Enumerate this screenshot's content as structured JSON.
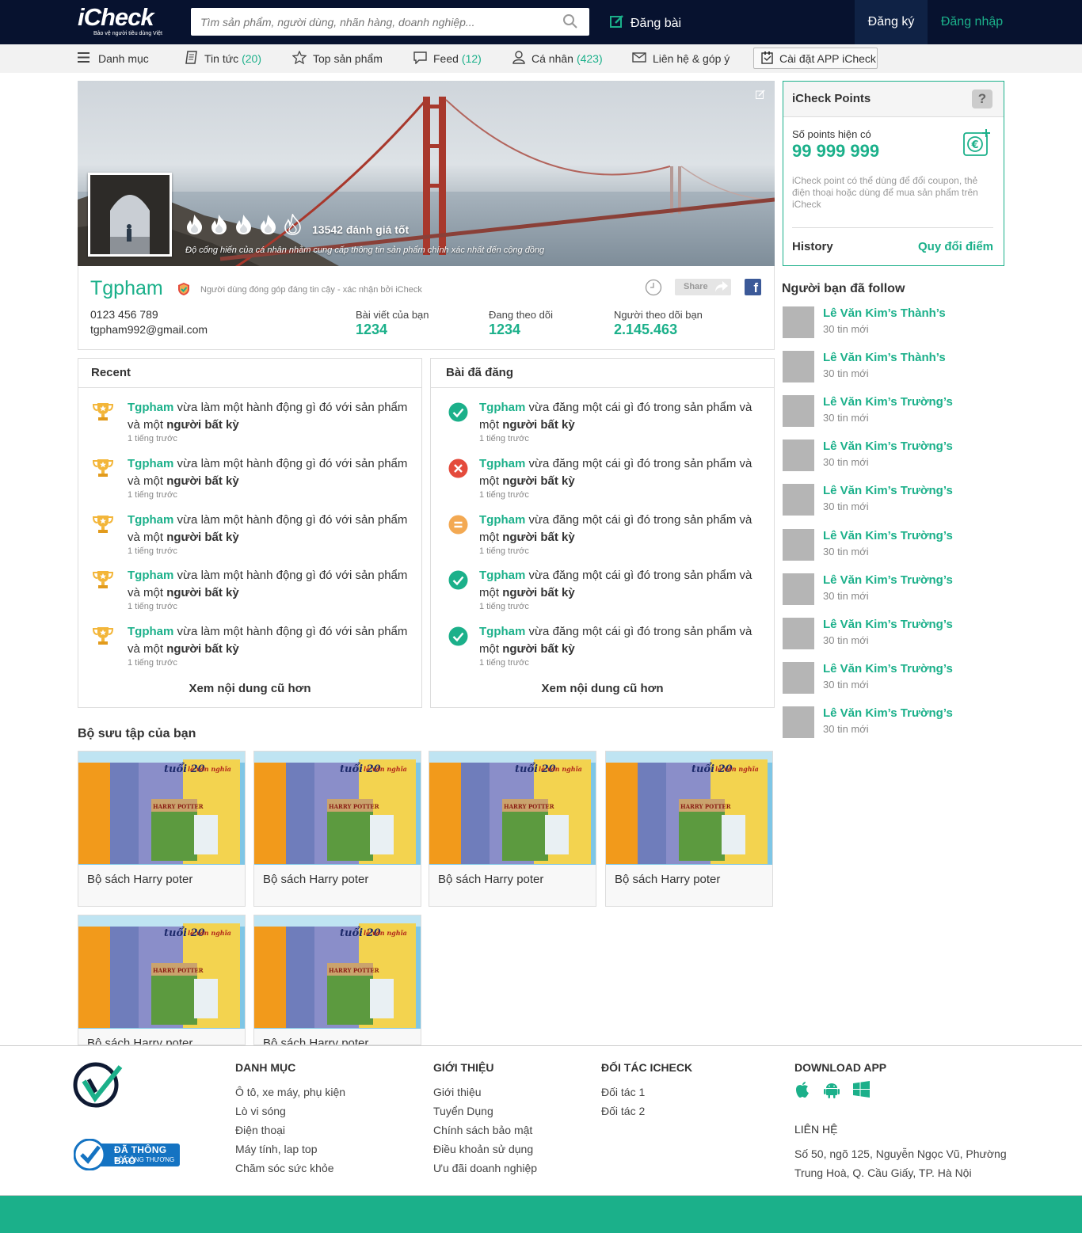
{
  "header": {
    "logo_text": "iCheck",
    "logo_tagline": "Bảo vệ người tiêu dùng Việt",
    "search_placeholder": "Tìm sản phẩm, người dùng, nhãn hàng, doanh nghiệp...",
    "post_label": "Đăng bài",
    "register_label": "Đăng ký",
    "login_label": "Đăng nhập"
  },
  "nav": {
    "menu": "Danh mục",
    "news": "Tin tức",
    "news_count": "(20)",
    "top_products": "Top sản phẩm",
    "feed": "Feed",
    "feed_count": "(12)",
    "personal": "Cá nhân",
    "personal_count": "(423)",
    "contact": "Liên hệ & góp ý",
    "install_app": "Cài đặt APP iCheck"
  },
  "profile": {
    "rating_text": "13542 đánh giá tốt",
    "contribution_text": "Độ cống hiến của cá nhân nhằm cung cấp thông tin sản phẩm chính xác nhất đến cộng đồng",
    "flames_filled": 4,
    "flames_total": 5,
    "name": "Tgpham",
    "verified_text": "Người dùng đóng góp đáng tin cậy - xác nhận bởi iCheck",
    "phone": "0123 456 789",
    "email": "tgpham992@gmail.com",
    "share_label": "Share",
    "stats": [
      {
        "label": "Bài viết của bạn",
        "value": "1234"
      },
      {
        "label": "Đang theo dõi",
        "value": "1234"
      },
      {
        "label": "Người theo dõi bạn",
        "value": "2.145.463"
      }
    ]
  },
  "recent": {
    "title": "Recent",
    "more": "Xem nội dung cũ hơn",
    "items": [
      {
        "user": "Tgpham",
        "text": " vừa làm một hành động gì đó với sản phẩm và một ",
        "target": "người bất kỳ",
        "time": "1 tiếng trước"
      },
      {
        "user": "Tgpham",
        "text": " vừa làm một hành động gì đó với sản phẩm và một ",
        "target": "người bất kỳ",
        "time": "1 tiếng trước"
      },
      {
        "user": "Tgpham",
        "text": " vừa làm một hành động gì đó với sản phẩm và một ",
        "target": "người bất kỳ",
        "time": "1 tiếng trước"
      },
      {
        "user": "Tgpham",
        "text": " vừa làm một hành động gì đó với sản phẩm và một ",
        "target": "người bất kỳ",
        "time": "1 tiếng trước"
      },
      {
        "user": "Tgpham",
        "text": " vừa làm một hành động gì đó với sản phẩm và một ",
        "target": "người bất kỳ",
        "time": "1 tiếng trước"
      }
    ]
  },
  "posted": {
    "title": "Bài đã đăng",
    "more": "Xem nội dung cũ hơn",
    "items": [
      {
        "status": "approved",
        "user": "Tgpham",
        "text": " vừa đăng một cái gì đó trong sản phẩm và một ",
        "target": "người bất kỳ",
        "time": "1 tiếng trước"
      },
      {
        "status": "rejected",
        "user": "Tgpham",
        "text": " vừa đăng một cái gì đó trong sản phẩm và một ",
        "target": "người bất kỳ",
        "time": "1 tiếng trước"
      },
      {
        "status": "pending",
        "user": "Tgpham",
        "text": " vừa đăng một cái gì đó trong sản phẩm và một ",
        "target": "người bất kỳ",
        "time": "1 tiếng trước"
      },
      {
        "status": "approved",
        "user": "Tgpham",
        "text": " vừa đăng một cái gì đó trong sản phẩm và một ",
        "target": "người bất kỳ",
        "time": "1 tiếng trước"
      },
      {
        "status": "approved",
        "user": "Tgpham",
        "text": " vừa đăng một cái gì đó trong sản phẩm và một ",
        "target": "người bất kỳ",
        "time": "1 tiếng trước"
      }
    ]
  },
  "points": {
    "title": "iCheck Points",
    "help": "?",
    "current_label": "Số points hiện có",
    "value": "99 999 999",
    "desc": "iCheck point có thể dùng để đổi coupon, thẻ điện thoại hoặc dùng để mua sản phẩm trên iCheck",
    "history": "History",
    "redeem": "Quy đổi điểm"
  },
  "following": {
    "title": "Người bạn đã follow",
    "items": [
      {
        "name": "Lê Văn Kim’s Thành’s",
        "sub": "30 tin mới"
      },
      {
        "name": "Lê Văn Kim’s Thành’s",
        "sub": "30 tin mới"
      },
      {
        "name": "Lê Văn Kim’s Trường’s",
        "sub": "30 tin mới"
      },
      {
        "name": "Lê Văn Kim’s Trường’s",
        "sub": "30 tin mới"
      },
      {
        "name": "Lê Văn Kim’s Trường’s",
        "sub": "30 tin mới"
      },
      {
        "name": "Lê Văn Kim’s Trường’s",
        "sub": "30 tin mới"
      },
      {
        "name": "Lê Văn Kim’s Trường’s",
        "sub": "30 tin mới"
      },
      {
        "name": "Lê Văn Kim’s Trường’s",
        "sub": "30 tin mới"
      },
      {
        "name": "Lê Văn Kim’s Trường’s",
        "sub": "30 tin mới"
      },
      {
        "name": "Lê Văn Kim’s Trường’s",
        "sub": "30 tin mới"
      }
    ]
  },
  "collection": {
    "title": "Bộ sưu tập của bạn",
    "book_cover_texts": [
      "tuổi 20",
      "HARRY POTTER",
      "lê văn nghĩa"
    ],
    "items": [
      {
        "title": "Bộ sách Harry poter"
      },
      {
        "title": "Bộ sách Harry poter"
      },
      {
        "title": "Bộ sách Harry poter"
      },
      {
        "title": "Bộ sách Harry poter"
      },
      {
        "title": "Bộ sách Harry poter"
      },
      {
        "title": "Bộ sách Harry poter"
      }
    ]
  },
  "footer": {
    "badge_line1": "ĐÃ THÔNG BÁO",
    "badge_line2": "BỘ CÔNG THƯƠNG",
    "categories": {
      "title": "DANH MỤC",
      "links": [
        "Ô tô, xe máy, phụ kiện",
        "Lò vi sóng",
        "Điện thoại",
        "Máy tính, lap top",
        "Chăm sóc sức khỏe"
      ]
    },
    "about": {
      "title": "GIỚI THIỆU",
      "links": [
        "Giới thiệu",
        "Tuyển Dụng",
        "Chính sách bảo mật",
        "Điều khoản sử dụng",
        "Ưu đãi doanh nghiệp"
      ]
    },
    "partners": {
      "title": "ĐỐI TÁC ICHECK",
      "links": [
        "Đối tác 1",
        "Đối tác 2"
      ]
    },
    "download": {
      "title": "DOWNLOAD APP",
      "icons": [
        "apple-icon",
        "android-icon",
        "windows-icon"
      ]
    },
    "contact": {
      "title": "LIÊN HỆ",
      "address_line1": "Số 50, ngõ 125, Nguyễn Ngọc Vũ, Phường",
      "address_line2": "Trung Hoà, Q. Cầu Giấy, TP. Hà Nội"
    }
  },
  "colors": {
    "brand_green": "#1bb08a",
    "header_bg": "#07122f",
    "register_bg": "#0f2245",
    "approved": "#1bb08a",
    "rejected": "#e44b3c",
    "pending": "#f3a953"
  }
}
